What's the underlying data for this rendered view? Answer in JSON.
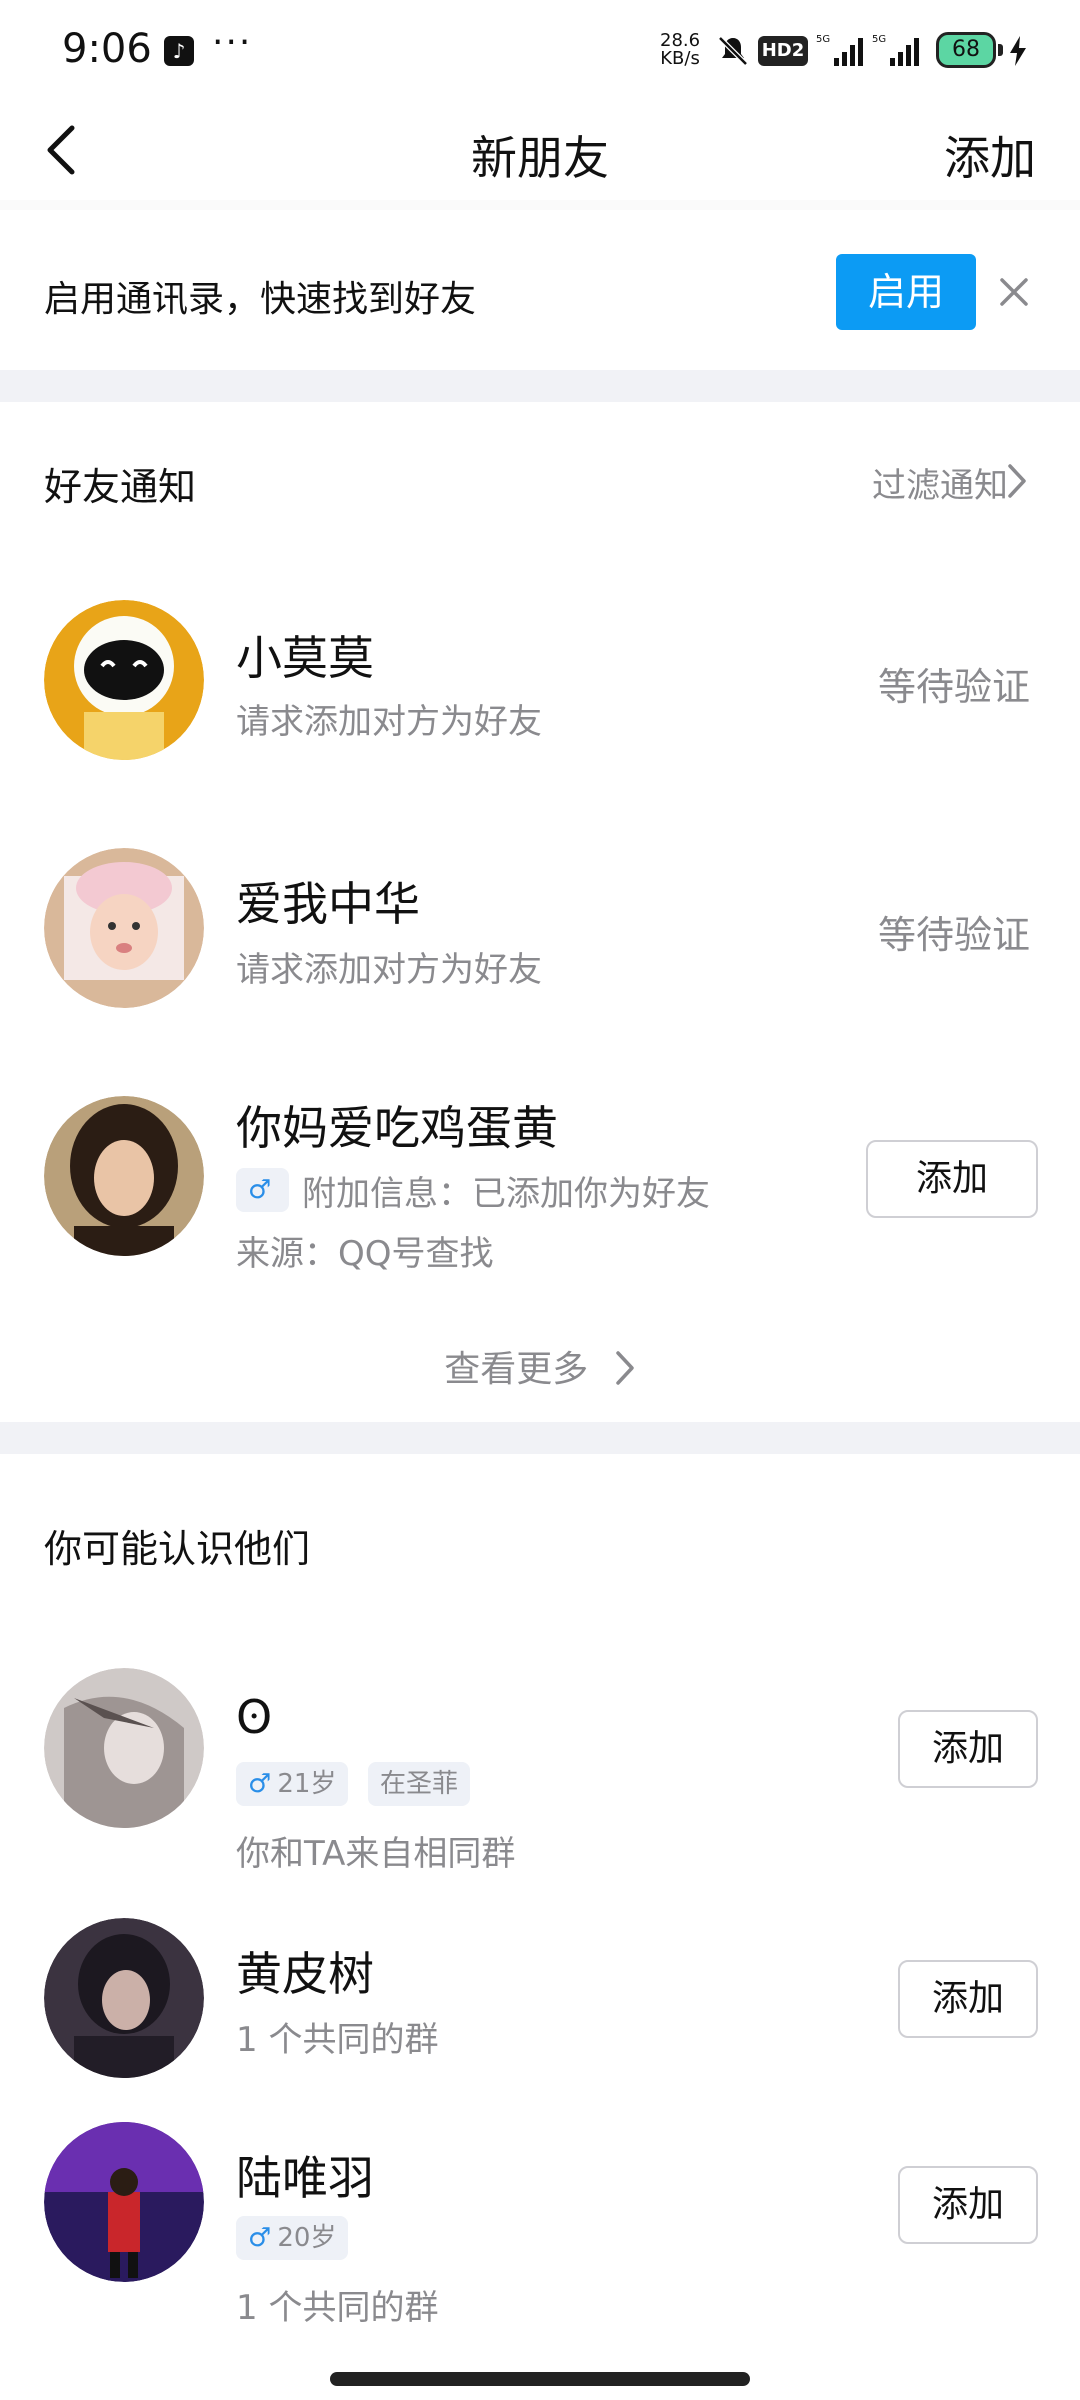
{
  "status_bar": {
    "time": "9:06",
    "dots": "···",
    "speed_value": "28.6",
    "speed_unit": "KB/s",
    "hd_label": "HD2",
    "battery": "68"
  },
  "header": {
    "title": "新朋友",
    "add_label": "添加"
  },
  "contacts_banner": {
    "text": "启用通讯录，快速找到好友",
    "enable_label": "启用"
  },
  "friend_notifications": {
    "title": "好友通知",
    "filter_label": "过滤通知",
    "items": [
      {
        "name": "小莫莫",
        "detail": "请求添加对方为好友",
        "status": "等待验证"
      },
      {
        "name": "爱我中华",
        "detail": "请求添加对方为好友",
        "status": "等待验证"
      },
      {
        "name": "你妈爱吃鸡蛋黄",
        "extra_info": "附加信息：已添加你为好友",
        "source": "来源：QQ号查找",
        "action_label": "添加"
      }
    ],
    "see_more_label": "查看更多"
  },
  "suggestions": {
    "title": "你可能认识他们",
    "items": [
      {
        "name": "ʘ",
        "tags": [
          "21岁",
          "在圣菲"
        ],
        "detail": "你和TA来自相同群",
        "action_label": "添加"
      },
      {
        "name": "黄皮树",
        "detail": "1 个共同的群",
        "action_label": "添加"
      },
      {
        "name": "陆唯羽",
        "tags": [
          "20岁"
        ],
        "detail": "1 个共同的群",
        "action_label": "添加"
      }
    ]
  },
  "colors": {
    "accent": "#0c9bf4",
    "secondary_text": "#8a8a8e",
    "divider": "#f1f2f6",
    "male": "#2a8ee8"
  }
}
